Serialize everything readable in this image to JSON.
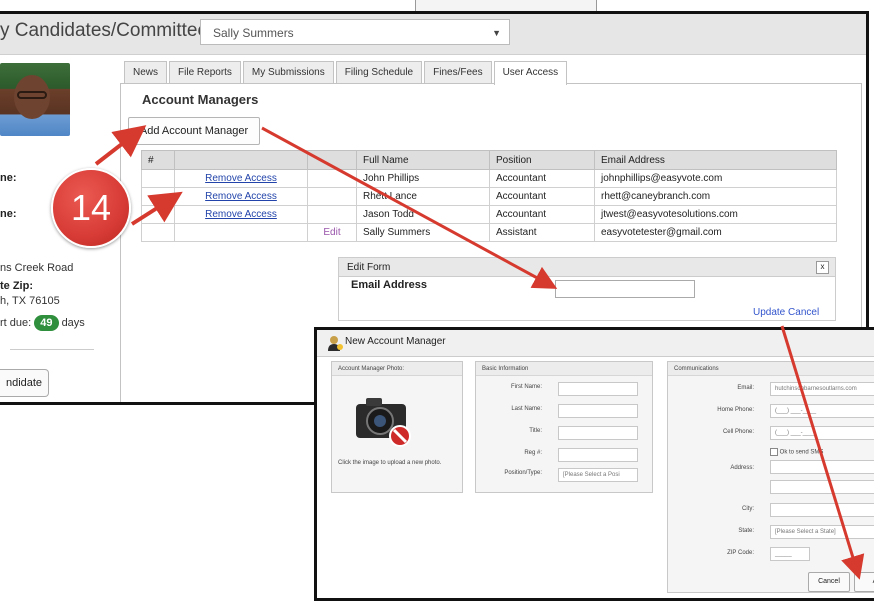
{
  "header": {
    "title": "y Candidates/Committees",
    "selected_candidate": "Sally Summers"
  },
  "profile": {
    "label1": "ne:",
    "label2": "ne:",
    "address": "ns Creek Road",
    "zip_label": "te Zip:",
    "city": "h, TX 76105",
    "report_due_prefix": "rt due:",
    "days_count": "49",
    "days_suffix": "days",
    "candidate_button": "ndidate"
  },
  "tabs": [
    {
      "label": "News"
    },
    {
      "label": "File Reports"
    },
    {
      "label": "My Submissions"
    },
    {
      "label": "Filing Schedule"
    },
    {
      "label": "Fines/Fees"
    },
    {
      "label": "User Access"
    }
  ],
  "account_managers": {
    "title": "Account Managers",
    "add_button": "Add Account Manager",
    "columns": [
      "#",
      "",
      "Full Name",
      "Position",
      "Email Address"
    ],
    "rows": [
      {
        "action": "Remove Access",
        "edit": "",
        "name": "John Phillips",
        "position": "Accountant",
        "email": "johnphillips@easyvote.com"
      },
      {
        "action": "Remove Access",
        "edit": "",
        "name": "Rhett Lance",
        "position": "Accountant",
        "email": "rhett@caneybranch.com"
      },
      {
        "action": "Remove Access",
        "edit": "",
        "name": "Jason Todd",
        "position": "Accountant",
        "email": "jtwest@easyvotesolutions.com"
      },
      {
        "action": "",
        "edit": "Edit",
        "name": "Sally Summers",
        "position": "Assistant",
        "email": "easyvotetester@gmail.com"
      }
    ]
  },
  "edit_form": {
    "title": "Edit Form",
    "close": "x",
    "email_label": "Email Address",
    "email_value": "",
    "update": "Update",
    "cancel": "Cancel"
  },
  "step_badge": "14",
  "dialog": {
    "title": "New Account Manager",
    "photo_section": "Account Manager Photo:",
    "photo_hint": "Click the image to upload a new photo.",
    "basic_section": "Basic Information",
    "basic_fields": [
      {
        "label": "First Name:",
        "value": ""
      },
      {
        "label": "Last Name:",
        "value": ""
      },
      {
        "label": "Title:",
        "value": ""
      },
      {
        "label": "Reg #:",
        "value": ""
      }
    ],
    "position_label": "Position/Type:",
    "position_value": "[Please Select a Posi",
    "comm_section": "Communications",
    "email_label": "Email:",
    "email_value": "hutchinsonbarnesoutlarns.com",
    "home_phone_label": "Home Phone:",
    "home_phone_value": "(___) ___-____",
    "cell_phone_label": "Cell Phone:",
    "cell_phone_value": "(___) ___-____",
    "sms_label": "Ok to send SMS",
    "address_label": "Address:",
    "city_label": "City:",
    "state_label": "State:",
    "state_value": "[Please Select a State]",
    "zip_label": "ZIP Code:",
    "zip_value": "_____",
    "cancel_button": "Cancel",
    "add_button": "A"
  },
  "colors": {
    "arrow": "#d63a2f",
    "badge": "#d83b35",
    "days_badge": "#2f8f3d",
    "link": "#2244aa"
  }
}
